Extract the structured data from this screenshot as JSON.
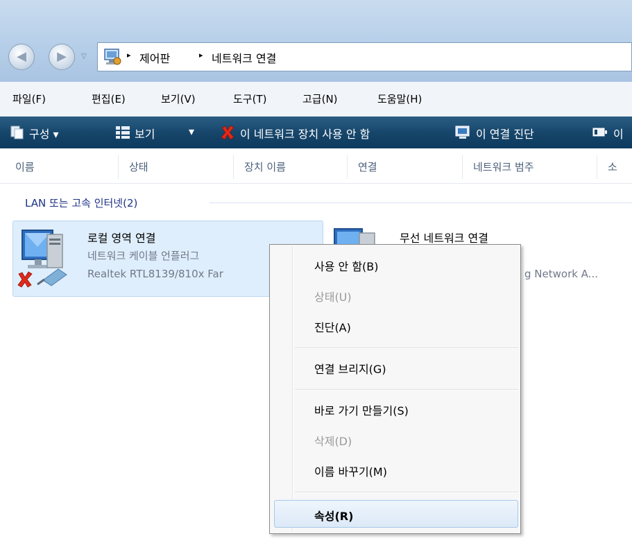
{
  "address": {
    "crumbs": [
      "제어판",
      "네트워크 연결"
    ],
    "separator": "▸"
  },
  "menu": [
    "파일(F)",
    "편집(E)",
    "보기(V)",
    "도구(T)",
    "고급(N)",
    "도움말(H)"
  ],
  "toolbar": {
    "organize": "구성 ▾",
    "view": "보기",
    "view_arrow": "▾",
    "disable_device": "이 네트워크 장치 사용 안 함",
    "diagnose": "이 연결 진단",
    "truncated": "이"
  },
  "columns": [
    "이름",
    "상태",
    "장치 이름",
    "연결",
    "네트워크 범주",
    "소"
  ],
  "group": {
    "header": "LAN 또는 고속 인터넷(2)"
  },
  "items": [
    {
      "name": "로컬 영역 연결",
      "status": "네트워크 케이블 언플러그",
      "device": "Realtek RTL8139/810x Far"
    },
    {
      "name": "무선 네트워크 연결",
      "device": "g Network A..."
    }
  ],
  "context_menu": {
    "items": [
      {
        "label": "사용 안 함(B)",
        "enabled": true
      },
      {
        "label": "상태(U)",
        "enabled": false
      },
      {
        "label": "진단(A)",
        "enabled": true
      },
      {
        "label": "연결 브리지(G)",
        "enabled": true
      },
      {
        "label": "바로 가기 만들기(S)",
        "enabled": true
      },
      {
        "label": "삭제(D)",
        "enabled": false
      },
      {
        "label": "이름 바꾸기(M)",
        "enabled": true
      },
      {
        "label": "속성(R)",
        "enabled": true,
        "highlighted": true,
        "bold": true
      }
    ]
  },
  "colors": {
    "toolbar": "#17466b",
    "titlebar": "#b9d1ea",
    "selection": "#dfeefc",
    "group_header": "#1e3287"
  }
}
